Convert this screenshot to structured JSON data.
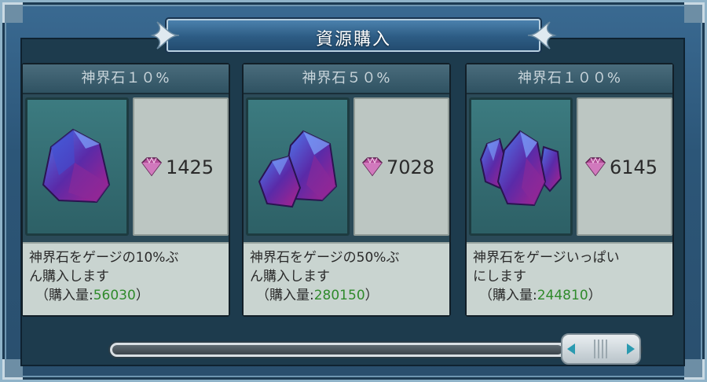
{
  "dialog": {
    "title": "資源購入"
  },
  "currency_icon": "gem-icon",
  "colors": {
    "frame": "#2c5678",
    "amount_green": "#2f8a2b",
    "gem": "#a24a8e"
  },
  "cards": [
    {
      "name": "神界石１０%",
      "image": "crystal-small-icon",
      "price": "1425",
      "desc_line1": "神界石をゲージの10%ぶ",
      "desc_line2": "ん購入します",
      "amount_label": "（購入量:",
      "amount_value": "56030",
      "amount_close": "）"
    },
    {
      "name": "神界石５０%",
      "image": "crystal-medium-icon",
      "price": "7028",
      "desc_line1": "神界石をゲージの50%ぶ",
      "desc_line2": "ん購入します",
      "amount_label": "（購入量:",
      "amount_value": "280150",
      "amount_close": "）"
    },
    {
      "name": "神界石１００%",
      "image": "crystal-cluster-icon",
      "price": "6145",
      "desc_line1": "神界石をゲージいっぱい",
      "desc_line2": "にします",
      "amount_label": "（購入量:",
      "amount_value": "244810",
      "amount_close": "）"
    }
  ],
  "scrollbar": {
    "position": 1.0
  }
}
